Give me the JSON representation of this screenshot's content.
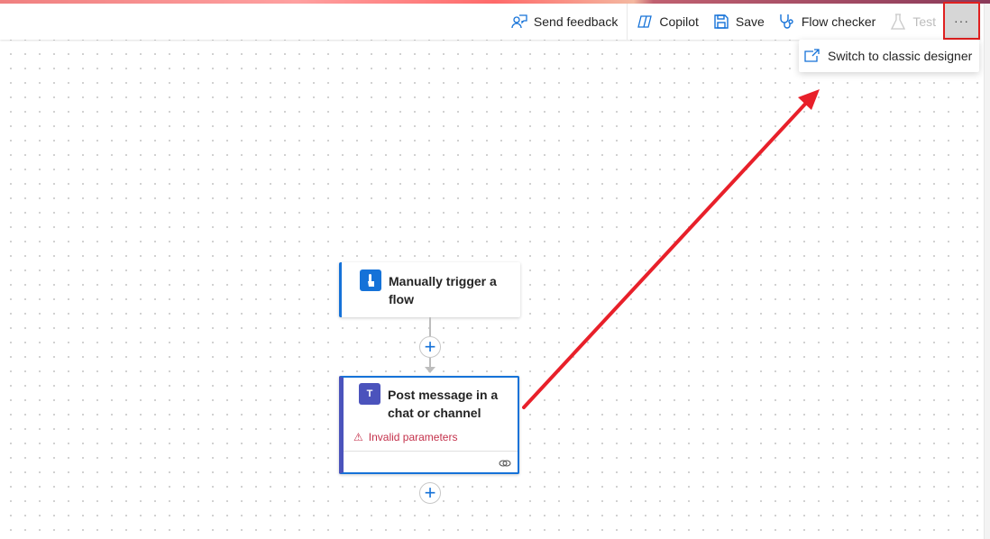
{
  "toolbar": {
    "send_feedback": "Send feedback",
    "copilot": "Copilot",
    "save": "Save",
    "flow_checker": "Flow checker",
    "test": "Test",
    "more": "···"
  },
  "menu": {
    "switch_classic": "Switch to classic designer"
  },
  "nodes": [
    {
      "title": "Manually trigger a flow",
      "icon": "manual-trigger-icon"
    },
    {
      "title": "Post message in a chat or channel",
      "icon": "teams-icon",
      "error": "Invalid parameters"
    }
  ],
  "colors": {
    "accent": "#1572d8",
    "error": "#c4314b",
    "teams": "#4b53bc",
    "annotation": "#e8202a"
  }
}
